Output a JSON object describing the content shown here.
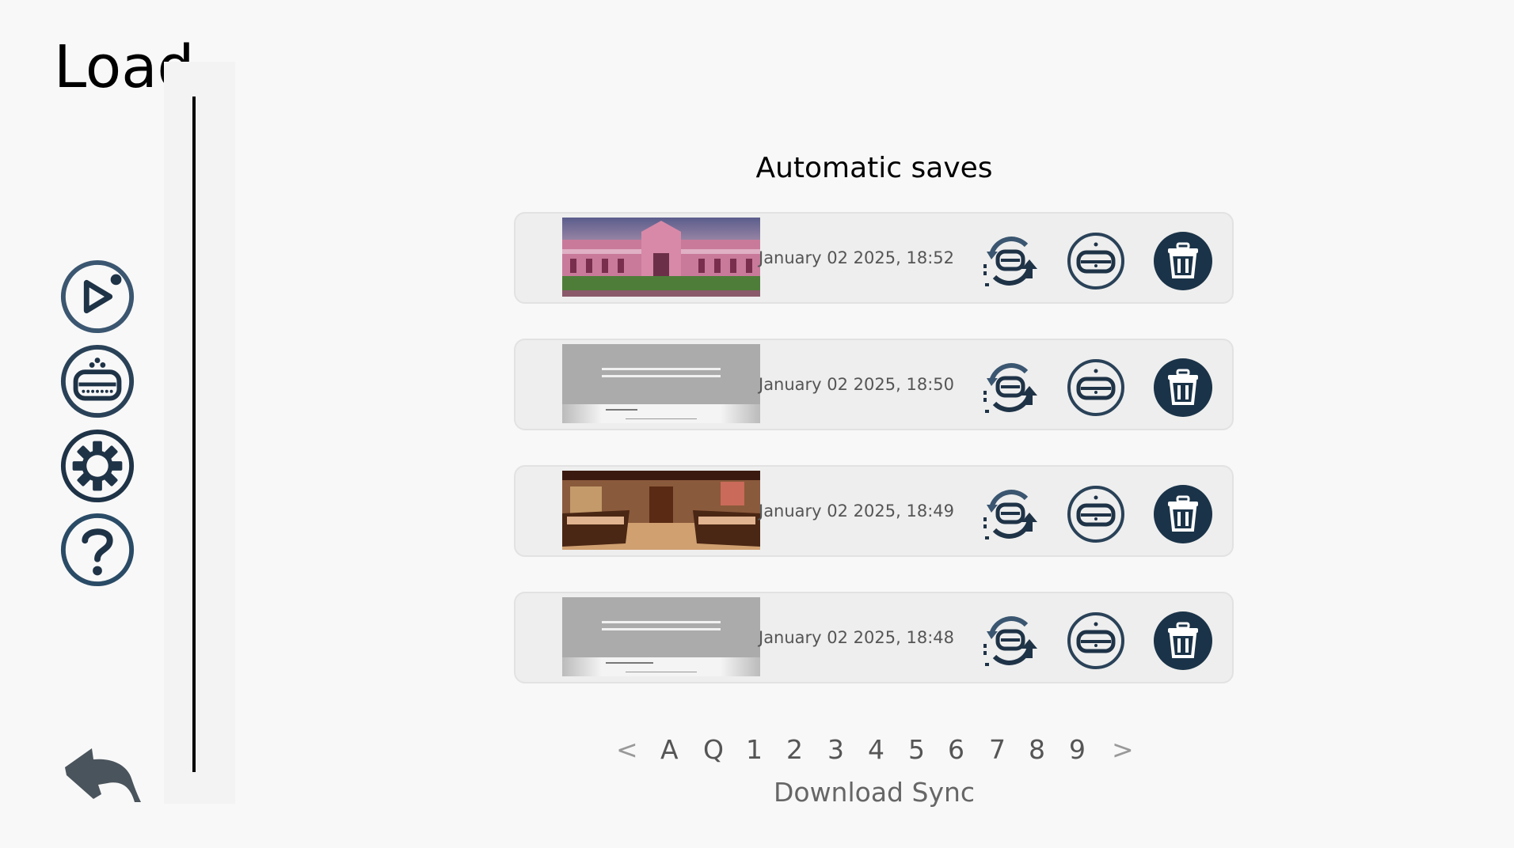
{
  "title": "Load",
  "nav": {
    "items": [
      {
        "name": "play-icon"
      },
      {
        "name": "save-disk-icon"
      },
      {
        "name": "gear-icon"
      },
      {
        "name": "help-icon"
      }
    ],
    "back": {
      "name": "back-arrow-icon"
    }
  },
  "section_title": "Automatic saves",
  "slots": [
    {
      "date": "January 02 2025, 18:52",
      "thumbnail": "castle courtyard scene"
    },
    {
      "date": "January 02 2025, 18:50",
      "thumbnail": "grey ui screenshot"
    },
    {
      "date": "January 02 2025, 18:49",
      "thumbnail": "bakery shop interior"
    },
    {
      "date": "January 02 2025, 18:48",
      "thumbnail": "grey ui screenshot"
    }
  ],
  "slot_actions": [
    "load-sync-icon",
    "save-disk-icon",
    "trash-icon"
  ],
  "pager": {
    "prev": "<",
    "pages": [
      "A",
      "Q",
      "1",
      "2",
      "3",
      "4",
      "5",
      "6",
      "7",
      "8",
      "9"
    ],
    "next": ">"
  },
  "download_sync": "Download Sync",
  "colors": {
    "background": "#f8f8f8",
    "slot_bg": "#eeeeee",
    "icon_dark": "#1f3347",
    "icon_mid": "#3b5670"
  }
}
